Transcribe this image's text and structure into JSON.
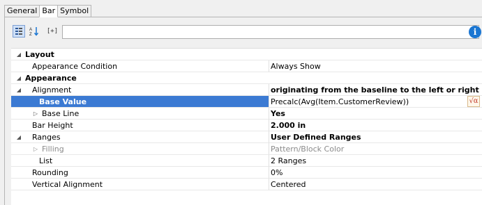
{
  "tabs": [
    {
      "label": "General"
    },
    {
      "label": "Bar"
    },
    {
      "label": "Symbol"
    }
  ],
  "toolbar": {
    "categorized_icon": "categorized-icon",
    "sort_icon": "sort-az-icon",
    "expand_label": "[+]"
  },
  "selector": {
    "value": ""
  },
  "info_button": {
    "label": "i"
  },
  "properties": [
    {
      "name": "Layout",
      "value": ""
    },
    {
      "name": "Appearance Condition",
      "value": "Always Show"
    },
    {
      "name": "Appearance",
      "value": ""
    },
    {
      "name": "Alignment",
      "value": "originating from the baseline to the left or right"
    },
    {
      "name": "Base Value",
      "value": "Precalc(Avg(Item.CustomerReview))"
    },
    {
      "name": "Base Line",
      "value": "Yes"
    },
    {
      "name": "Bar Height",
      "value": "2.000 in"
    },
    {
      "name": "Ranges",
      "value": "User Defined Ranges"
    },
    {
      "name": "Filling",
      "value": "Pattern/Block Color"
    },
    {
      "name": "List",
      "value": "2 Ranges"
    },
    {
      "name": "Rounding",
      "value": "0%"
    },
    {
      "name": "Vertical Alignment",
      "value": "Centered"
    }
  ],
  "formula_button": {
    "label": "√α"
  },
  "colors": {
    "selection": "#3b7ad3",
    "info": "#1b76d2"
  }
}
